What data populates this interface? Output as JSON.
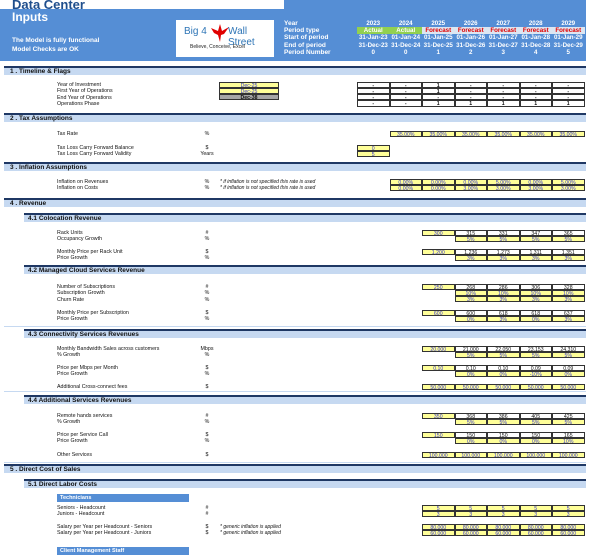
{
  "header": {
    "title": "Data Center",
    "subtitle": "Inputs",
    "status_lines": [
      "The Model is fully functional",
      "Model Checks are OK"
    ],
    "logo": {
      "text_left": "Big 4",
      "text_right": "Wall Street",
      "tagline": "Believe, Conceive, Excel",
      "icon": "eagle-icon"
    },
    "row_labels": [
      "Year",
      "Period type",
      "Start of period",
      "End of period",
      "Period Number"
    ],
    "years": [
      "2023",
      "2024",
      "2025",
      "2026",
      "2027",
      "2028",
      "2029"
    ],
    "period_types": [
      "Actual",
      "Actual",
      "Forecast",
      "Forecast",
      "Forecast",
      "Forecast",
      "Forecast"
    ],
    "start_dates": [
      "31-Jan-23",
      "01-Jan-24",
      "01-Jan-25",
      "01-Jan-26",
      "01-Jan-27",
      "01-Jan-28",
      "01-Jan-29"
    ],
    "end_dates": [
      "31-Dec-23",
      "31-Dec-24",
      "31-Dec-25",
      "31-Dec-26",
      "31-Dec-27",
      "31-Dec-28",
      "31-Dec-29"
    ],
    "period_numbers": [
      "0",
      "0",
      "1",
      "2",
      "3",
      "4",
      "5"
    ]
  },
  "colors": {
    "header_blue": "#558ed5",
    "actual_green": "#92d050",
    "forecast_red": "#e00000",
    "input_yellow": "#ffff99",
    "section_fill": "#c6d9f1"
  },
  "sections": {
    "timeline": {
      "title": "1 . Timeline & Flags",
      "rows": [
        {
          "label": "Year of Investment",
          "input": "Dec-25",
          "values": [
            "-",
            "-",
            "1",
            "-",
            "-",
            "-",
            "-"
          ]
        },
        {
          "label": "First Year of Operations",
          "input": "Dec-25",
          "values": [
            "-",
            "-",
            "1",
            "-",
            "-",
            "-",
            "-"
          ]
        },
        {
          "label": "End Year of Operations",
          "input": "Dec-38",
          "values": [
            "-",
            "-",
            "-",
            "-",
            "-",
            "-",
            "-"
          ]
        },
        {
          "label": "Operations Phase",
          "input": "",
          "values": [
            "-",
            "-",
            "1",
            "1",
            "1",
            "1",
            "1"
          ]
        }
      ]
    },
    "tax": {
      "title": "2 . Tax Assumptions",
      "tax_rate": {
        "label": "Tax Rate",
        "unit": "%",
        "values": [
          "35.00%",
          "35.00%",
          "35.00%",
          "35.00%",
          "35.00%",
          "35.00%"
        ]
      },
      "tlcf_balance": {
        "label": "Tax Loss Carry Forward Balance",
        "unit": "$",
        "value": "0"
      },
      "tlcf_validity": {
        "label": "Tax Loss Carry Forward Validity",
        "unit": "Years",
        "value": "5"
      }
    },
    "inflation": {
      "title": "3 . Inflation Assumptions",
      "rows": [
        {
          "label": "Inflation on Revenues",
          "unit": "%",
          "note": "* if inflation is not specified this rate is used",
          "values": [
            "0.00%",
            "0.00%",
            "0.00%",
            "5.00%",
            "0.00%",
            "5.00%"
          ]
        },
        {
          "label": "Inflation on Costs",
          "unit": "%",
          "note": "* if inflation is not specified this rate is used",
          "values": [
            "0.00%",
            "0.00%",
            "3.00%",
            "3.00%",
            "3.00%",
            "3.00%"
          ]
        }
      ]
    },
    "revenue": {
      "title": "4 . Revenue",
      "colocation": {
        "title": "4.1   Colocation Revenue",
        "rack_units": {
          "label": "Rack Units",
          "unit": "#",
          "input": "300",
          "values": [
            "315",
            "331",
            "347",
            "365"
          ]
        },
        "occupancy_growth": {
          "label": "Occupancy Growth",
          "unit": "%",
          "values": [
            "5%",
            "5%",
            "5%",
            "5%"
          ]
        },
        "price": {
          "label": "Monthly Price per Rack Unit",
          "unit": "$",
          "input": "1,200",
          "values": [
            "1,236",
            "1,273",
            "1,311",
            "1,351"
          ]
        },
        "price_growth": {
          "label": "Price Growth",
          "unit": "%",
          "values": [
            "3%",
            "3%",
            "3%",
            "3%"
          ]
        }
      },
      "cloud": {
        "title": "4.2   Managed Cloud Services Revenue",
        "subs": {
          "label": "Number of Subscriptions",
          "unit": "#",
          "input": "250",
          "values": [
            "268",
            "286",
            "306",
            "328"
          ]
        },
        "sub_growth": {
          "label": "Subscription Growth",
          "unit": "%",
          "values": [
            "10%",
            "10%",
            "10%",
            "10%"
          ]
        },
        "churn": {
          "label": "Churn Rate",
          "unit": "%",
          "values": [
            "3%",
            "3%",
            "3%",
            "3%"
          ]
        },
        "price": {
          "label": "Monthly Price per Subscription",
          "unit": "$",
          "input": "600",
          "values": [
            "600",
            "618",
            "618",
            "637"
          ]
        },
        "price_growth": {
          "label": "Price Growth",
          "unit": "%",
          "values": [
            "0%",
            "3%",
            "0%",
            "3%"
          ]
        }
      },
      "connectivity": {
        "title": "4.3   Connectivity Services Revenues",
        "bandwidth": {
          "label": "Monthly Bandwidth Sales across customers",
          "unit": "Mbps",
          "input": "20,000",
          "values": [
            "21,000",
            "22,050",
            "23,153",
            "24,310"
          ]
        },
        "bw_growth": {
          "label": "% Growth",
          "unit": "%",
          "values": [
            "5%",
            "5%",
            "5%",
            "5%"
          ]
        },
        "price": {
          "label": "Price per Mbps per Month",
          "unit": "$",
          "input": "0.10",
          "values": [
            "0.10",
            "0.10",
            "0.09",
            "0.09"
          ]
        },
        "price_growth": {
          "label": "Price Growth",
          "unit": "%",
          "values": [
            "0%",
            "0%",
            "-10%",
            "0%"
          ]
        },
        "cross_connect": {
          "label": "Additional Cross-connect fees",
          "unit": "$",
          "values": [
            "50,000",
            "50,000",
            "50,000",
            "50,000",
            "50,000"
          ]
        }
      },
      "additional": {
        "title": "4.4   Additional Services Revenues",
        "remote_hands": {
          "label": "Remote hands services",
          "unit": "#",
          "input": "350",
          "values": [
            "368",
            "386",
            "405",
            "425"
          ]
        },
        "rh_growth": {
          "label": "% Growth",
          "unit": "%",
          "values": [
            "5%",
            "5%",
            "5%",
            "5%"
          ]
        },
        "price": {
          "label": "Price per Service Call",
          "unit": "$",
          "input": "150",
          "values": [
            "150",
            "150",
            "150",
            "165"
          ]
        },
        "price_growth": {
          "label": "Price Growth",
          "unit": "%",
          "values": [
            "0%",
            "0%",
            "0%",
            "10%"
          ]
        },
        "other": {
          "label": "Other Services",
          "unit": "$",
          "values": [
            "100,000",
            "100,000",
            "100,000",
            "100,000",
            "100,000"
          ]
        }
      }
    },
    "direct_cost": {
      "title": "5 . Direct Cost of Sales",
      "labor": {
        "title": "5.1   Direct Labor Costs",
        "technicians_title": "Technicians",
        "seniors_hc": {
          "label": "Seniors - Headcount",
          "unit": "#",
          "values": [
            "5",
            "5",
            "5",
            "5",
            "5"
          ]
        },
        "juniors_hc": {
          "label": "Juniors - Headcount",
          "unit": "#",
          "values": [
            "3",
            "3",
            "3",
            "3",
            "3"
          ]
        },
        "seniors_sal": {
          "label": "Salary per Year per Headcount - Seniors",
          "unit": "$",
          "note": "* generic inflation is applied",
          "values": [
            "80,000",
            "80,000",
            "80,000",
            "80,000",
            "80,000"
          ]
        },
        "juniors_sal": {
          "label": "Salary per Year per Headcount - Juniors",
          "unit": "$",
          "note": "* generic inflation is applied",
          "values": [
            "60,000",
            "60,000",
            "60,000",
            "60,000",
            "60,000"
          ]
        },
        "client_mgmt_title": "Client Management Staff"
      }
    }
  }
}
